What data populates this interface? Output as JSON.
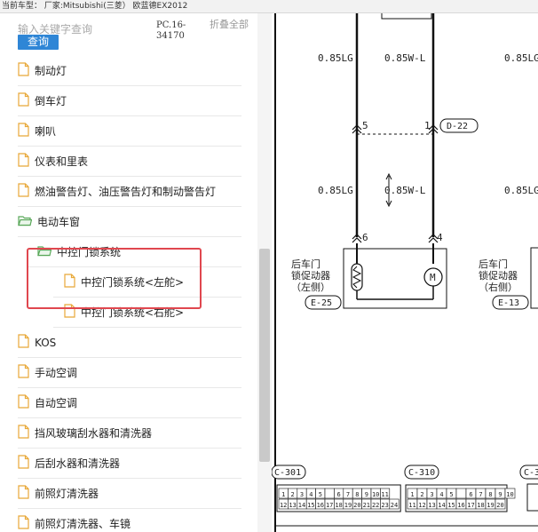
{
  "header": {
    "text": "当前车型： 厂家:Mitsubishi(三菱） 欧蓝德EX2012"
  },
  "search": {
    "placeholder": "输入关键字查询",
    "button_label": "查询"
  },
  "doc": {
    "code": "PC.16-34170",
    "collapse_label": "折叠全部"
  },
  "tree": {
    "items": [
      {
        "label": "制动灯",
        "icon": "file-icon",
        "level": 1
      },
      {
        "label": "倒车灯",
        "icon": "file-icon",
        "level": 1
      },
      {
        "label": "喇叭",
        "icon": "file-icon",
        "level": 1
      },
      {
        "label": "仪表和里表",
        "icon": "file-icon",
        "level": 1
      },
      {
        "label": "燃油警告灯、油压警告灯和制动警告灯",
        "icon": "file-icon",
        "level": 1
      },
      {
        "label": "电动车窗",
        "icon": "folder-open-icon",
        "level": 1
      },
      {
        "label": "中控门锁系统",
        "icon": "folder-open-icon",
        "level": 2
      },
      {
        "label": "中控门锁系统<左舵>",
        "icon": "file-icon",
        "level": 3
      },
      {
        "label": "中控门锁系统<右舵>",
        "icon": "file-icon",
        "level": 3
      },
      {
        "label": "KOS",
        "icon": "file-icon",
        "level": 1
      },
      {
        "label": "手动空调",
        "icon": "file-icon",
        "level": 1
      },
      {
        "label": "自动空调",
        "icon": "file-icon",
        "level": 1
      },
      {
        "label": "挡风玻璃刮水器和清洗器",
        "icon": "file-icon",
        "level": 1
      },
      {
        "label": "后刮水器和清洗器",
        "icon": "file-icon",
        "level": 1
      },
      {
        "label": "前照灯清洗器",
        "icon": "file-icon",
        "level": 1
      },
      {
        "label": "前照灯清洗器、车镜",
        "icon": "file-icon",
        "level": 1
      }
    ]
  },
  "diagram": {
    "wire_labels": [
      "0.85LG",
      "0.85W-L",
      "0.85LG",
      "0.85LG",
      "0.85W-L",
      "0.85LG"
    ],
    "pins": [
      "5",
      "1",
      "6",
      "4"
    ],
    "connector_d22": "D-22",
    "actuator_left": [
      "后车门",
      "锁促动器",
      "（左侧）"
    ],
    "actuator_right": [
      "后车门",
      "锁促动器",
      "（右侧）"
    ],
    "connector_e25": "E-25",
    "connector_e13": "E-13",
    "connector_c301": "C-301",
    "connector_c310": "C-310",
    "connector_c3": "C-3",
    "c301_top": [
      "1",
      "2",
      "3",
      "4",
      "5",
      "",
      "6",
      "7",
      "8",
      "9",
      "10",
      "11"
    ],
    "c301_bottom": [
      "12",
      "13",
      "14",
      "15",
      "16",
      "17",
      "18",
      "19",
      "20",
      "21",
      "22",
      "23",
      "24"
    ],
    "c310_top": [
      "1",
      "2",
      "3",
      "4",
      "5",
      "",
      "6",
      "7",
      "8",
      "9",
      "10"
    ],
    "c310_bottom": [
      "11",
      "12",
      "13",
      "14",
      "15",
      "16",
      "17",
      "18",
      "19",
      "20"
    ],
    "motor_symbol": "M"
  },
  "colors": {
    "accent": "#2f86d6",
    "highlight": "#e0474f",
    "folder": "#5aa85a",
    "file": "#e8a838"
  }
}
